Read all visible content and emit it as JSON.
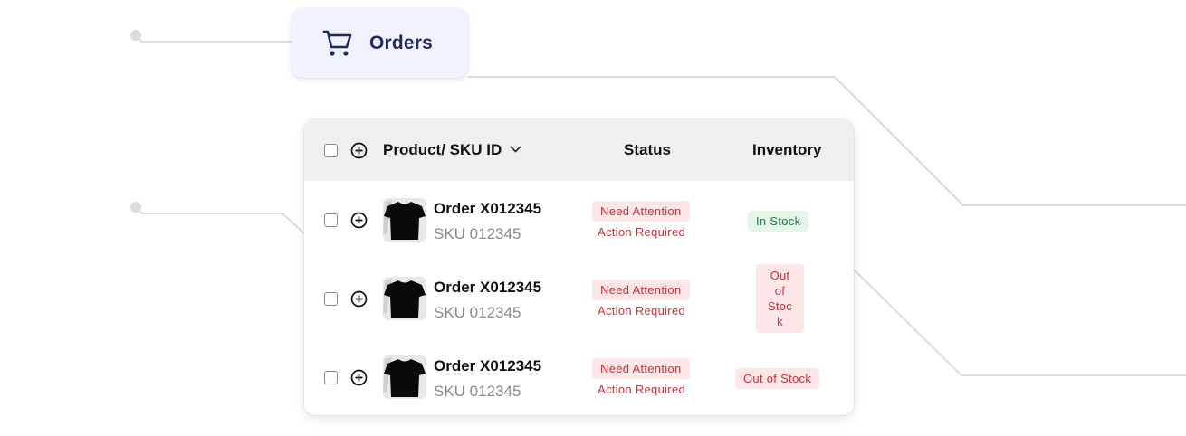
{
  "nav": {
    "orders_label": "Orders",
    "orders_icon": "shopping-cart-icon"
  },
  "table": {
    "columns": {
      "product": "Product/ SKU ID",
      "status": "Status",
      "inventory": "Inventory"
    },
    "rows": [
      {
        "order": "Order X012345",
        "sku": "SKU 012345",
        "status_badge": "Need Attention",
        "status_note": "Action Required",
        "inventory": "In Stock"
      },
      {
        "order": "Order X012345",
        "sku": "SKU 012345",
        "status_badge": "Need Attention",
        "status_note": "Action Required",
        "inventory_lines": [
          "Out",
          "of",
          "Stoc",
          "k"
        ]
      },
      {
        "order": "Order X012345",
        "sku": "SKU 012345",
        "status_badge": "Need Attention",
        "status_note": "Action Required",
        "inventory": "Out of Stock"
      }
    ]
  },
  "colors": {
    "accent_navy": "#1f2b5b",
    "danger_text": "#c0343d",
    "danger_bg": "#fde6e7",
    "success_text": "#1f7a3d",
    "success_bg": "#e4f6ea"
  }
}
